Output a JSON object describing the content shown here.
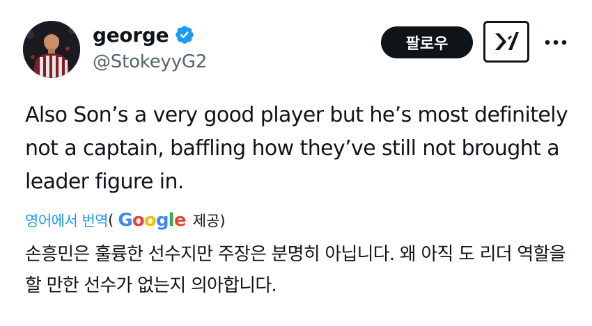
{
  "author": {
    "display_name": "george",
    "handle": "@StokeyyG2",
    "verified": true,
    "avatar": "profile-photo"
  },
  "actions": {
    "follow_label": "팔로우",
    "grok_icon": "grok-icon",
    "more_icon": "more-icon"
  },
  "tweet": {
    "text": "Also Son’s a very good player but he’s most definitely not a captain, baffling how they’ve still not brought a leader figure in."
  },
  "translation": {
    "link_label": "영어에서 번역",
    "open_paren": "(",
    "provider_g": "G",
    "provider_o1": "o",
    "provider_o2": "o",
    "provider_g2": "g",
    "provider_l": "l",
    "provider_e": "e",
    "provided_label": "제공)",
    "text": "손흥민은 훌륭한 선수지만 주장은 분명히 아닙니다. 왜 아직 도 리더 역할을 할 만한 선수가 없는지 의아합니다."
  },
  "colors": {
    "accent": "#1d9bf0",
    "text": "#0f1419",
    "muted": "#536471",
    "follow_bg": "#0f1419"
  }
}
